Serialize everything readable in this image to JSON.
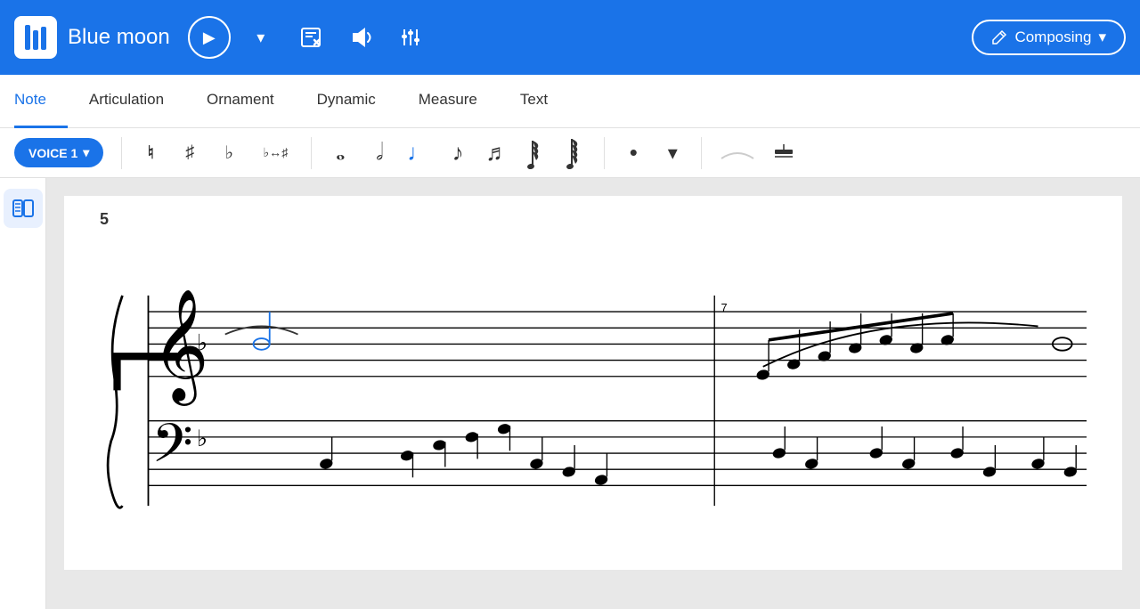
{
  "app": {
    "logo_alt": "MuseScore Logo",
    "title": "Blue moon"
  },
  "header": {
    "play_label": "▶",
    "dropdown_label": "▾",
    "icon1": "✕",
    "icon2": "🔊",
    "icon3": "⚙",
    "composing_label": "Composing",
    "composing_dropdown": "▾"
  },
  "tabs": [
    {
      "id": "note",
      "label": "Note",
      "active": true
    },
    {
      "id": "articulation",
      "label": "Articulation",
      "active": false
    },
    {
      "id": "ornament",
      "label": "Ornament",
      "active": false
    },
    {
      "id": "dynamic",
      "label": "Dynamic",
      "active": false
    },
    {
      "id": "measure",
      "label": "Measure",
      "active": false
    },
    {
      "id": "text",
      "label": "Text",
      "active": false
    }
  ],
  "note_toolbar": {
    "voice_label": "VOICE 1",
    "accidentals": [
      "♮",
      "♯",
      "♭",
      "♭↔♯"
    ],
    "notes": [
      "𝅝",
      "𝅗𝅥",
      "♩",
      "♪",
      "♬",
      "𝅘𝅥𝅯",
      "𝅘𝅥𝅮"
    ],
    "augmentation": "•",
    "more": "▾"
  },
  "score": {
    "measure_number": "5"
  }
}
